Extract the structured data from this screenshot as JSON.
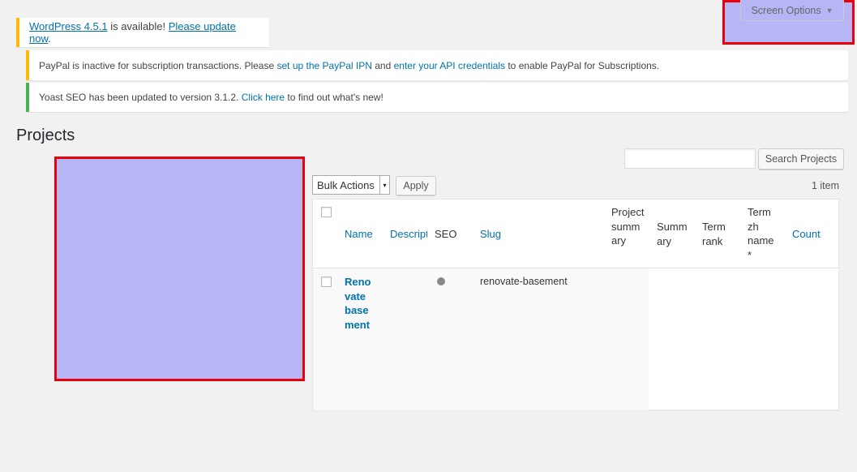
{
  "screen_options": {
    "label": "Screen Options",
    "arrow": "▼"
  },
  "notices": {
    "update": {
      "link1": "WordPress 4.5.1",
      "text1": " is available! ",
      "link2": "Please update now",
      "text2": "."
    },
    "paypal": {
      "text1": "PayPal is inactive for subscription transactions. Please ",
      "link1": "set up the PayPal IPN",
      "text2": " and ",
      "link2": "enter your API credentials",
      "text3": " to enable PayPal for Subscriptions."
    },
    "yoast": {
      "text1": "Yoast SEO has been updated to version 3.1.2. ",
      "link1": "Click here",
      "text2": " to find out what's new!"
    }
  },
  "page": {
    "title": "Projects"
  },
  "search": {
    "placeholder": "",
    "button": "Search Projects"
  },
  "bulk": {
    "selected": "Bulk Actions",
    "arrow": "▾",
    "apply": "Apply"
  },
  "item_count": "1 item",
  "table": {
    "headers": {
      "name": "Name",
      "description": "Descripti",
      "seo": "SEO",
      "slug": "Slug",
      "project_summary": "Project summary",
      "summary": "Summary",
      "term_rank": "Term rank",
      "term_zh_name": "Term zh name *",
      "count": "Count"
    },
    "rows": [
      {
        "name": "Renovate basement",
        "slug": "renovate-basement"
      }
    ]
  }
}
